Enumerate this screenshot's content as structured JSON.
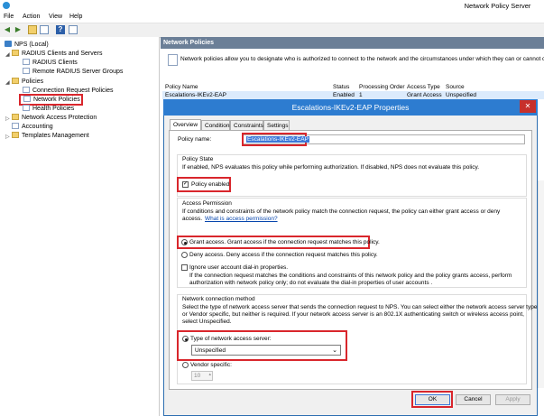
{
  "window": {
    "title": "Network Policy Server"
  },
  "menu": [
    "File",
    "Action",
    "View",
    "Help"
  ],
  "tree": {
    "root": "NPS (Local)",
    "radius_clients_servers": "RADIUS Clients and Servers",
    "radius_clients": "RADIUS Clients",
    "remote_groups": "Remote RADIUS Server Groups",
    "policies": "Policies",
    "connection_request": "Connection Request Policies",
    "network_policies": "Network Policies",
    "health_policies": "Health Policies",
    "nap": "Network Access Protection",
    "accounting": "Accounting",
    "templates": "Templates Management"
  },
  "right": {
    "header": "Network Policies",
    "description": "Network policies allow you to designate who is authorized to connect to the network and the circumstances under which they can or cannot connect.",
    "columns": [
      "Policy Name",
      "Status",
      "Processing Order",
      "Access Type",
      "Source"
    ],
    "row": [
      "Escalations-IKEv2-EAP",
      "Enabled",
      "1",
      "Grant Access",
      "Unspecified"
    ]
  },
  "dialog": {
    "title": "Escalations-IKEv2-EAP Properties",
    "tabs": [
      "Overview",
      "Conditions",
      "Constraints",
      "Settings"
    ],
    "policy_name_label": "Policy name:",
    "policy_name_value": "Escalations-IKEv2-EAP",
    "policy_state_title": "Policy State",
    "policy_state_desc": "If enabled, NPS evaluates this policy while performing authorization. If disabled, NPS does not evaluate this policy.",
    "policy_enabled": "Policy enabled",
    "access_permission_title": "Access Permission",
    "access_permission_desc1": "If conditions and constraints of the network policy match the connection request, the policy can either grant access or deny",
    "access_permission_desc2": "access.",
    "access_permission_link": "What is access permission?",
    "grant_access": "Grant access. Grant access if the connection request matches this policy.",
    "deny_access": "Deny access. Deny access if the connection request matches this policy.",
    "ignore_dialin": "Ignore user account dial-in properties.",
    "ignore_desc1": "If the connection request matches the conditions and constraints of this network policy and the policy grants access, perform",
    "ignore_desc2": "authorization with network policy only; do not evaluate the dial-in properties of user accounts .",
    "nc_method_title": "Network connection method",
    "nc_desc1": "Select the type of network access server that sends the connection request to NPS. You can select either the network access server type",
    "nc_desc2": "or Vendor specific, but neither is required.  If your network access server is an 802.1X authenticating switch or wireless access point,",
    "nc_desc3": "select Unspecified.",
    "type_nas": "Type of network access server:",
    "nas_value": "Unspecified",
    "vendor_specific": "Vendor specific:",
    "vendor_value": "10",
    "ok": "OK",
    "cancel": "Cancel",
    "apply": "Apply"
  }
}
